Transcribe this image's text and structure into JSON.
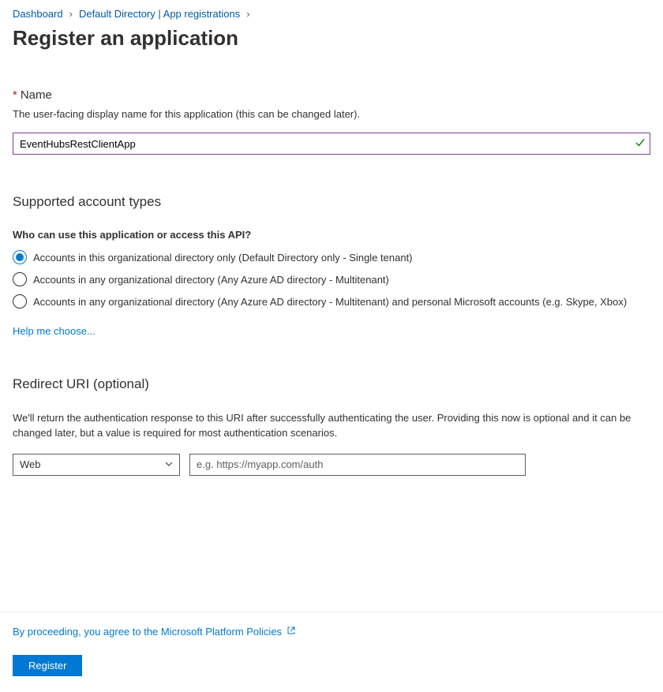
{
  "breadcrumb": {
    "items": [
      "Dashboard",
      "Default Directory | App registrations"
    ]
  },
  "page_title": "Register an application",
  "name_field": {
    "label": "Name",
    "helper": "The user-facing display name for this application (this can be changed later).",
    "value": "EventHubsRestClientApp"
  },
  "account_types": {
    "title": "Supported account types",
    "question": "Who can use this application or access this API?",
    "options": [
      "Accounts in this organizational directory only (Default Directory only - Single tenant)",
      "Accounts in any organizational directory (Any Azure AD directory - Multitenant)",
      "Accounts in any organizational directory (Any Azure AD directory - Multitenant) and personal Microsoft accounts (e.g. Skype, Xbox)"
    ],
    "help_link": "Help me choose..."
  },
  "redirect": {
    "title": "Redirect URI (optional)",
    "description": "We'll return the authentication response to this URI after successfully authenticating the user. Providing this now is optional and it can be changed later, but a value is required for most authentication scenarios.",
    "type_selected": "Web",
    "uri_placeholder": "e.g. https://myapp.com/auth"
  },
  "footer": {
    "policy_link": "By proceeding, you agree to the Microsoft Platform Policies",
    "register_label": "Register"
  }
}
